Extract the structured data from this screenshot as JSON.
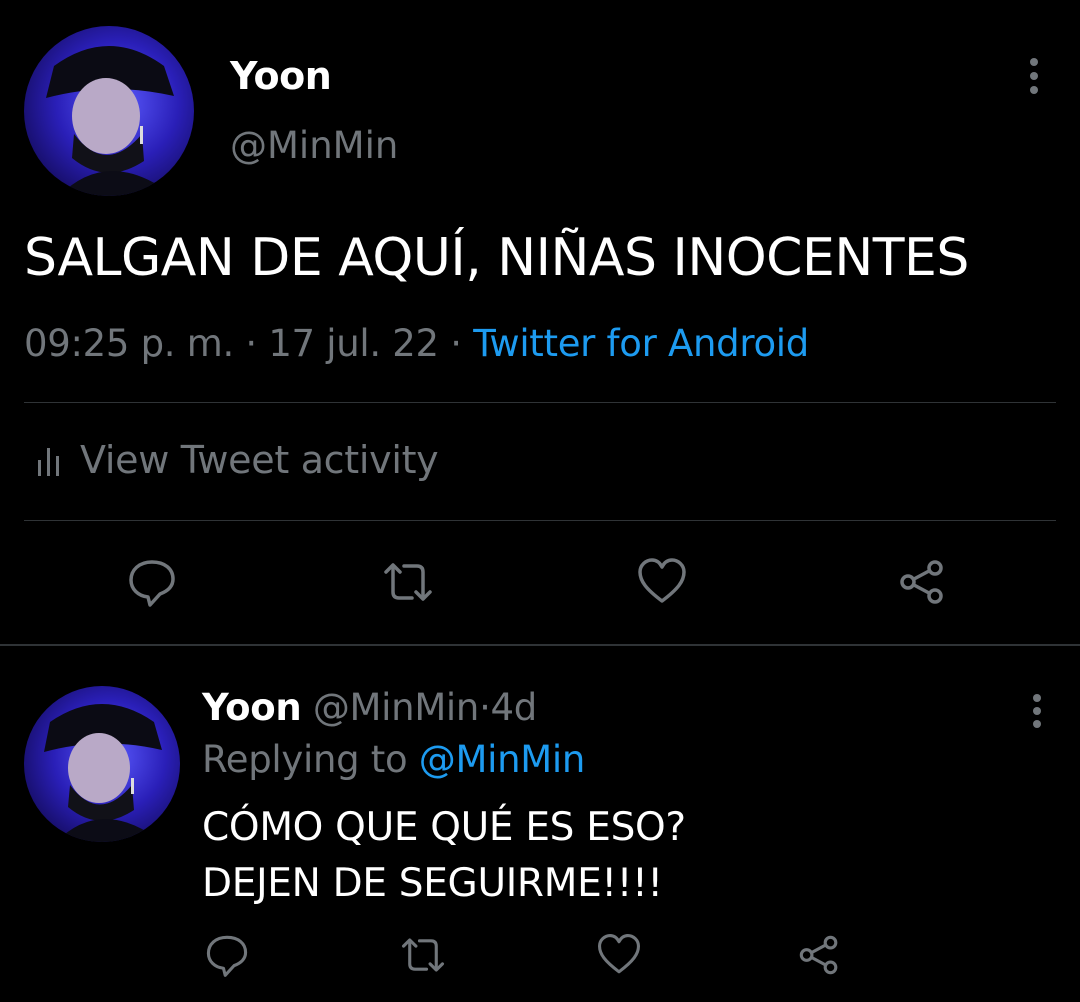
{
  "tweet": {
    "author": {
      "display_name": "Yoon",
      "handle": "@MinMin",
      "avatar": "avatar-photo"
    },
    "text": "SALGAN DE AQUÍ, NIÑAS INOCENTES",
    "time": "09:25 p. m.",
    "separator": "·",
    "date": "17 jul. 22",
    "source": "Twitter for Android",
    "activity_label": "View Tweet activity",
    "actions": [
      "reply-icon",
      "retweet-icon",
      "like-icon",
      "share-icon"
    ],
    "more_icon": "more-vertical-icon"
  },
  "reply": {
    "display_name": "Yoon",
    "handle": "@MinMin",
    "separator": "·",
    "age": "4d",
    "replying_prefix": "Replying to",
    "replying_to": "@MinMin",
    "text_line1": "CÓMO QUE QUÉ ES ESO?",
    "text_line2": "DEJEN DE SEGUIRME!!!!",
    "actions": [
      "reply-icon",
      "retweet-icon",
      "like-icon",
      "share-icon"
    ]
  },
  "colors": {
    "background": "#000000",
    "primary_text": "#ffffff",
    "secondary_text": "#71767b",
    "link": "#1d9bf0",
    "divider": "#2f3336"
  }
}
